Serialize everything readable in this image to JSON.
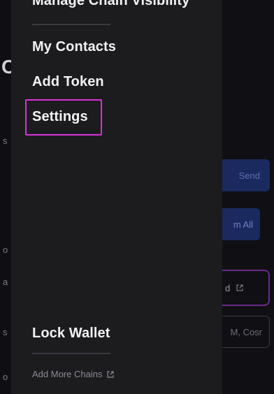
{
  "drawer": {
    "items": [
      {
        "label": "Manage Chain Visibility"
      },
      {
        "label": "My Contacts"
      },
      {
        "label": "Add Token"
      },
      {
        "label": "Settings"
      },
      {
        "label": "Lock Wallet"
      }
    ],
    "footer_link": "Add More Chains",
    "highlight_color": "#d633d6"
  },
  "background": {
    "left_big_char": "C",
    "send_label": "Send",
    "claim_label": "m All",
    "card_label": "d",
    "search_placeholder": "M, Cosr"
  }
}
